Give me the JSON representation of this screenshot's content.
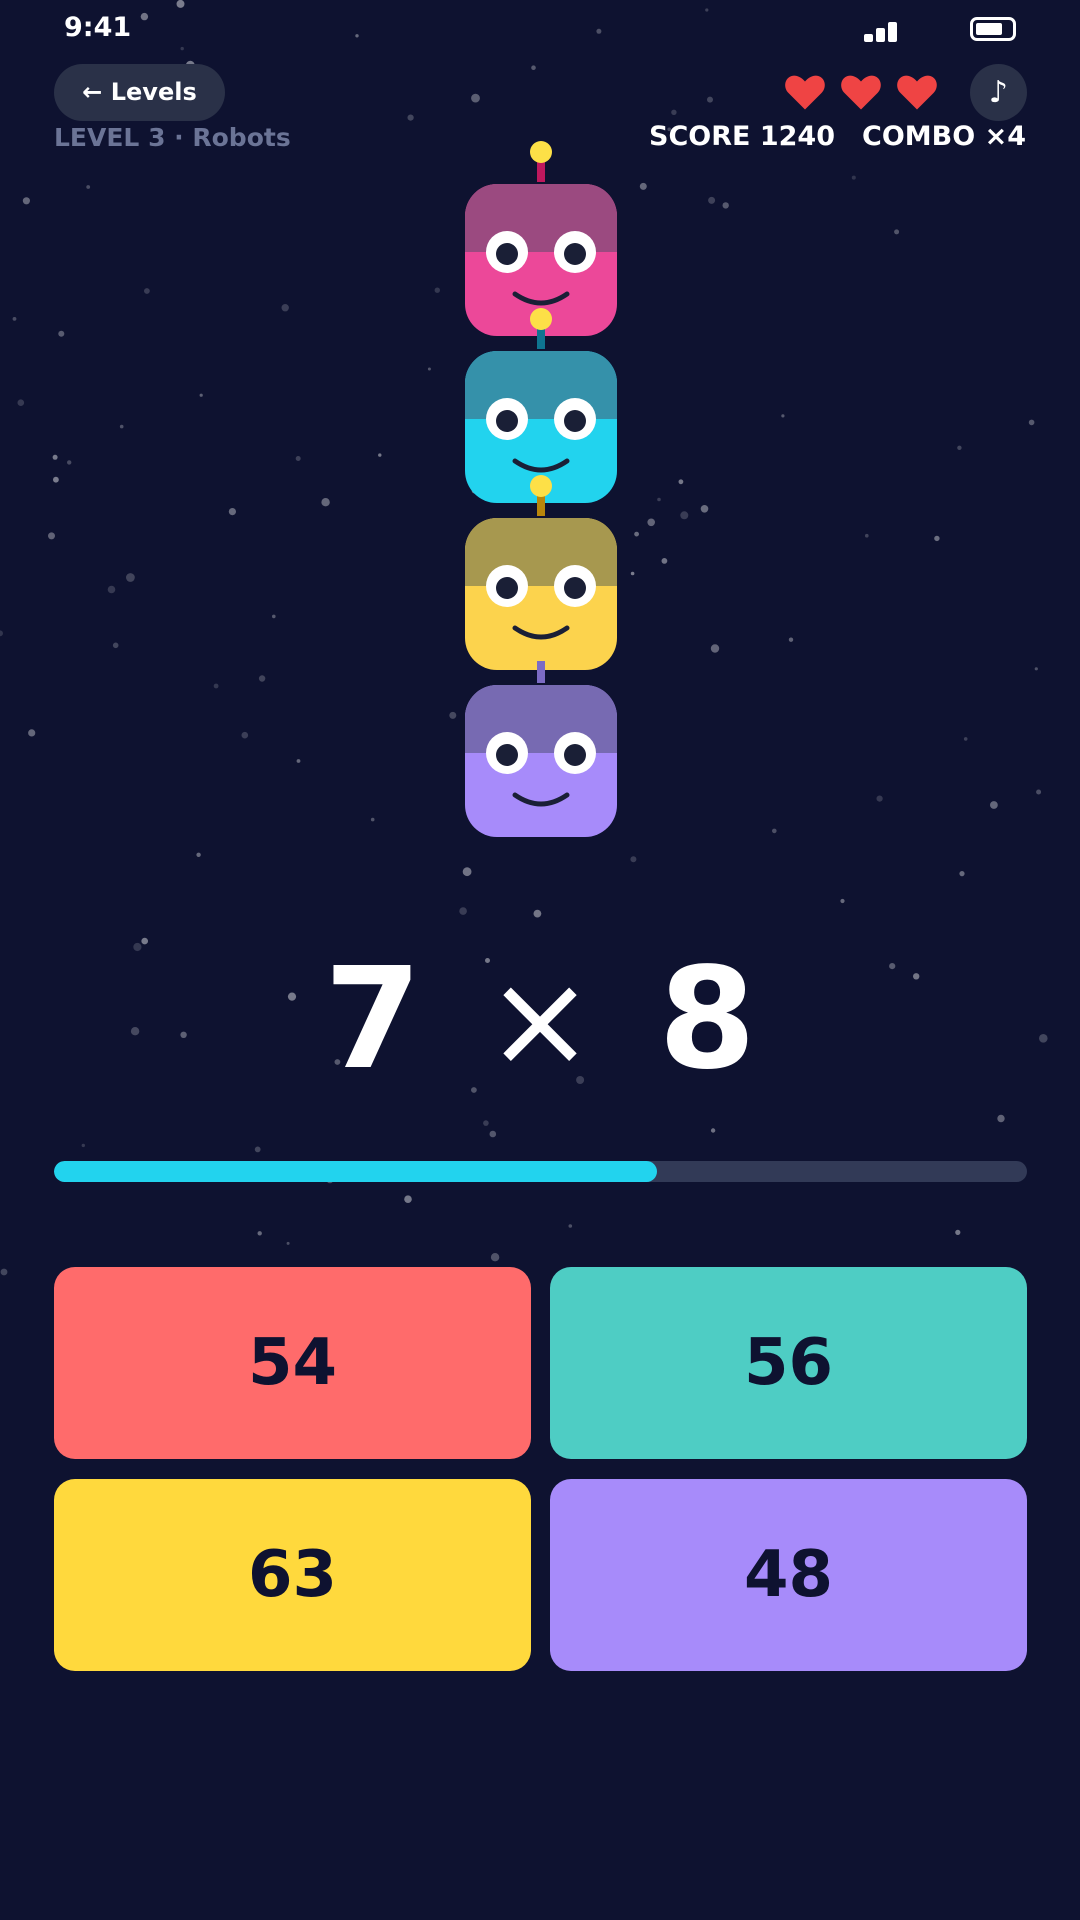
{
  "status_bar": {
    "time": "9:41",
    "battery_level": 0.75
  },
  "header": {
    "back_label": "← Levels",
    "music_icon": "♪",
    "lives": 3,
    "level_label": "LEVEL 3 · Robots",
    "score_label": "SCORE 1240",
    "combo_label": "COMBO ×4"
  },
  "robots": [
    {
      "name": "pink-robot",
      "color": "#ec4899",
      "top_color": "#9b4a80",
      "antenna_color": "#be185d",
      "antenna_ball": "#fde047"
    },
    {
      "name": "cyan-robot",
      "color": "#22d3ee",
      "top_color": "#3591aa",
      "antenna_color": "#0e7490",
      "antenna_ball": "#fde047"
    },
    {
      "name": "yellow-robot",
      "color": "#fcd34d",
      "top_color": "#a7984f",
      "antenna_color": "#b8860b",
      "antenna_ball": "#fde047"
    },
    {
      "name": "purple-robot",
      "color": "#a78bfa",
      "top_color": "#776ab2",
      "antenna_color": "#7c6bc4",
      "antenna_ball": null
    }
  ],
  "problem": {
    "left": "7",
    "operator": "×",
    "right": "8"
  },
  "timer": {
    "progress": 0.62,
    "color": "#22d3ee"
  },
  "answers": [
    {
      "label": "54",
      "color": "#ff6b6b"
    },
    {
      "label": "56",
      "color": "#4ecdc4"
    },
    {
      "label": "63",
      "color": "#ffd93d"
    },
    {
      "label": "48",
      "color": "#a78bfa"
    }
  ],
  "colors": {
    "background": "#0e1230",
    "heart": "#ef4444",
    "eye_white": "#ffffff",
    "pupil": "#1a1f36"
  }
}
